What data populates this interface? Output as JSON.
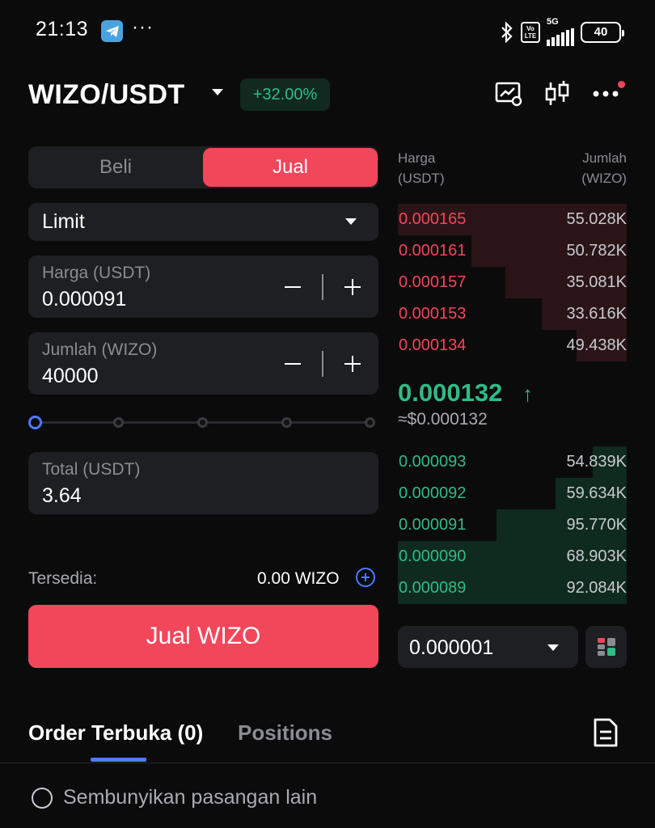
{
  "status_bar": {
    "time": "21:13",
    "overflow": "···",
    "network": "5G",
    "volte_top": "Vo",
    "volte_bottom": "LTE",
    "battery": "40"
  },
  "header": {
    "pair": "WIZO/USDT",
    "change": "+32.00%",
    "icons": [
      "chart-icon",
      "candlestick-icon",
      "more-icon"
    ]
  },
  "trade": {
    "tabs": {
      "buy": "Beli",
      "sell": "Jual"
    },
    "active_tab": "sell",
    "order_type": "Limit",
    "price": {
      "label": "Harga (USDT)",
      "value": "0.000091"
    },
    "amount": {
      "label": "Jumlah (WIZO)",
      "value": "40000"
    },
    "slider_percent": 0,
    "total": {
      "label": "Total (USDT)",
      "value": "3.64"
    },
    "available": {
      "label": "Tersedia:",
      "value": "0.00 WIZO"
    },
    "submit_label": "Jual WIZO"
  },
  "orderbook": {
    "price_header_1": "Harga",
    "price_header_2": "(USDT)",
    "amount_header_1": "Jumlah",
    "amount_header_2": "(WIZO)",
    "asks": [
      {
        "price": "0.000165",
        "amount": "55.028K",
        "depth": 1.0
      },
      {
        "price": "0.000161",
        "amount": "50.782K",
        "depth": 0.68
      },
      {
        "price": "0.000157",
        "amount": "35.081K",
        "depth": 0.53
      },
      {
        "price": "0.000153",
        "amount": "33.616K",
        "depth": 0.37
      },
      {
        "price": "0.000134",
        "amount": "49.438K",
        "depth": 0.22
      }
    ],
    "last_price": "0.000132",
    "last_price_arrow": "↑",
    "last_price_usd": "≈$0.000132",
    "bids": [
      {
        "price": "0.000093",
        "amount": "54.839K",
        "depth": 0.15
      },
      {
        "price": "0.000092",
        "amount": "59.634K",
        "depth": 0.31
      },
      {
        "price": "0.000091",
        "amount": "95.770K",
        "depth": 0.57
      },
      {
        "price": "0.000090",
        "amount": "68.903K",
        "depth": 1.0
      },
      {
        "price": "0.000089",
        "amount": "92.084K",
        "depth": 1.0
      }
    ],
    "precision": "0.000001"
  },
  "bottom": {
    "tab_open": "Order Terbuka (0)",
    "tab_positions": "Positions",
    "hide_pairs": "Sembunyikan pasangan lain"
  },
  "colors": {
    "sell": "#f2465a",
    "buy": "#2ebd85",
    "accent": "#4e7bff",
    "panel": "#1e1f22"
  }
}
